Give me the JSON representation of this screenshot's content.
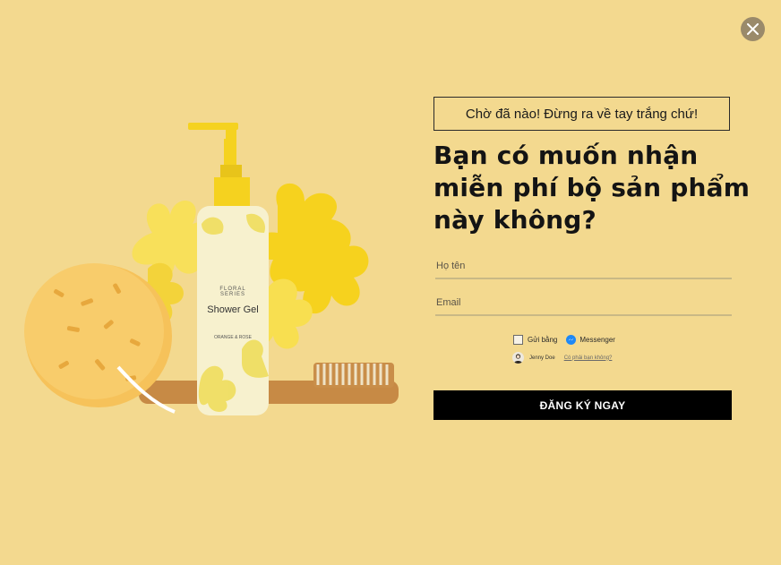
{
  "popup": {
    "close_label": "×",
    "tagline": "Chờ đã nào! Đừng ra về tay trắng chứ!",
    "headline": "Bạn có muốn nhận miễn phí bộ sản phẩm này không?",
    "form": {
      "name_placeholder": "Họ tên",
      "email_placeholder": "Email"
    },
    "messenger": {
      "send_label": "Gửi bằng",
      "platform_label": "Messenger",
      "user_name": "Jenny Doe",
      "not_you_label": "Có phải bạn không?"
    },
    "submit_label": "ĐĂNG KÝ NGAY"
  },
  "product": {
    "series_line1": "FLORAL",
    "series_line2": "SERIES",
    "name": "Shower Gel",
    "variant": "ORANGE & ROSE"
  },
  "colors": {
    "background": "#f3d98f",
    "button": "#000000",
    "messenger": "#1e88f5",
    "bottle_accent": "#f5d21f"
  }
}
